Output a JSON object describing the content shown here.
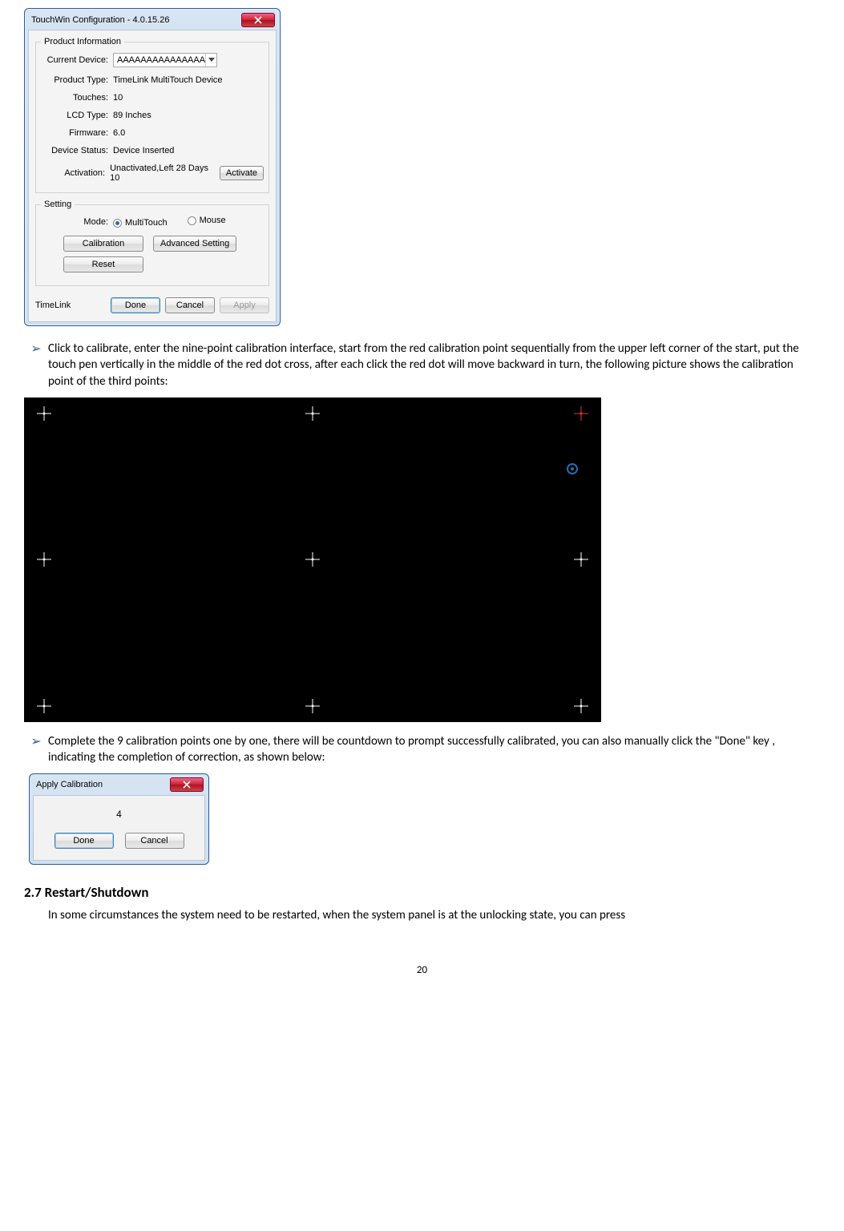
{
  "dialog": {
    "title": "TouchWin Configuration - 4.0.15.26",
    "group1_label": "Product Information",
    "fields": {
      "current_device_lbl": "Current Device:",
      "current_device_val": "AAAAAAAAAAAAAAA",
      "product_type_lbl": "Product Type:",
      "product_type_val": "TimeLink MultiTouch Device",
      "touches_lbl": "Touches:",
      "touches_val": "10",
      "lcd_lbl": "LCD Type:",
      "lcd_val": "89 Inches",
      "fw_lbl": "Firmware:",
      "fw_val": "6.0",
      "status_lbl": "Device Status:",
      "status_val": "Device Inserted",
      "activation_lbl": "Activation:",
      "activation_val": "Unactivated,Left 28 Days 10",
      "activate_btn": "Activate"
    },
    "group2_label": "Setting",
    "mode_lbl": "Mode:",
    "mode_multi": "MultiTouch",
    "mode_mouse": "Mouse",
    "calibration_btn": "Calibration",
    "advanced_btn": "Advanced Setting",
    "reset_btn": "Reset",
    "brand": "TimeLink",
    "done_btn": "Done",
    "cancel_btn": "Cancel",
    "apply_btn": "Apply"
  },
  "bullets": {
    "b1": "Click to calibrate, enter the nine-point calibration interface, start from the red calibration point sequentially from the upper left corner of the start, put the touch pen vertically in the middle of the red dot cross, after each click the red dot will move backward in turn, the following picture shows the calibration point of the third points:",
    "b2": "Complete the 9 calibration points one by one, there will be countdown to prompt successfully calibrated, you can also manually click the \"Done\" key , indicating the completion of correction, as shown below:"
  },
  "applycal": {
    "title": "Apply Calibration",
    "count": "4",
    "done": "Done",
    "cancel": "Cancel"
  },
  "section_heading": "2.7 Restart/Shutdown",
  "section_text": "In some circumstances the system need to be restarted, when the system panel is at the unlocking state, you can press",
  "page_number": "20"
}
